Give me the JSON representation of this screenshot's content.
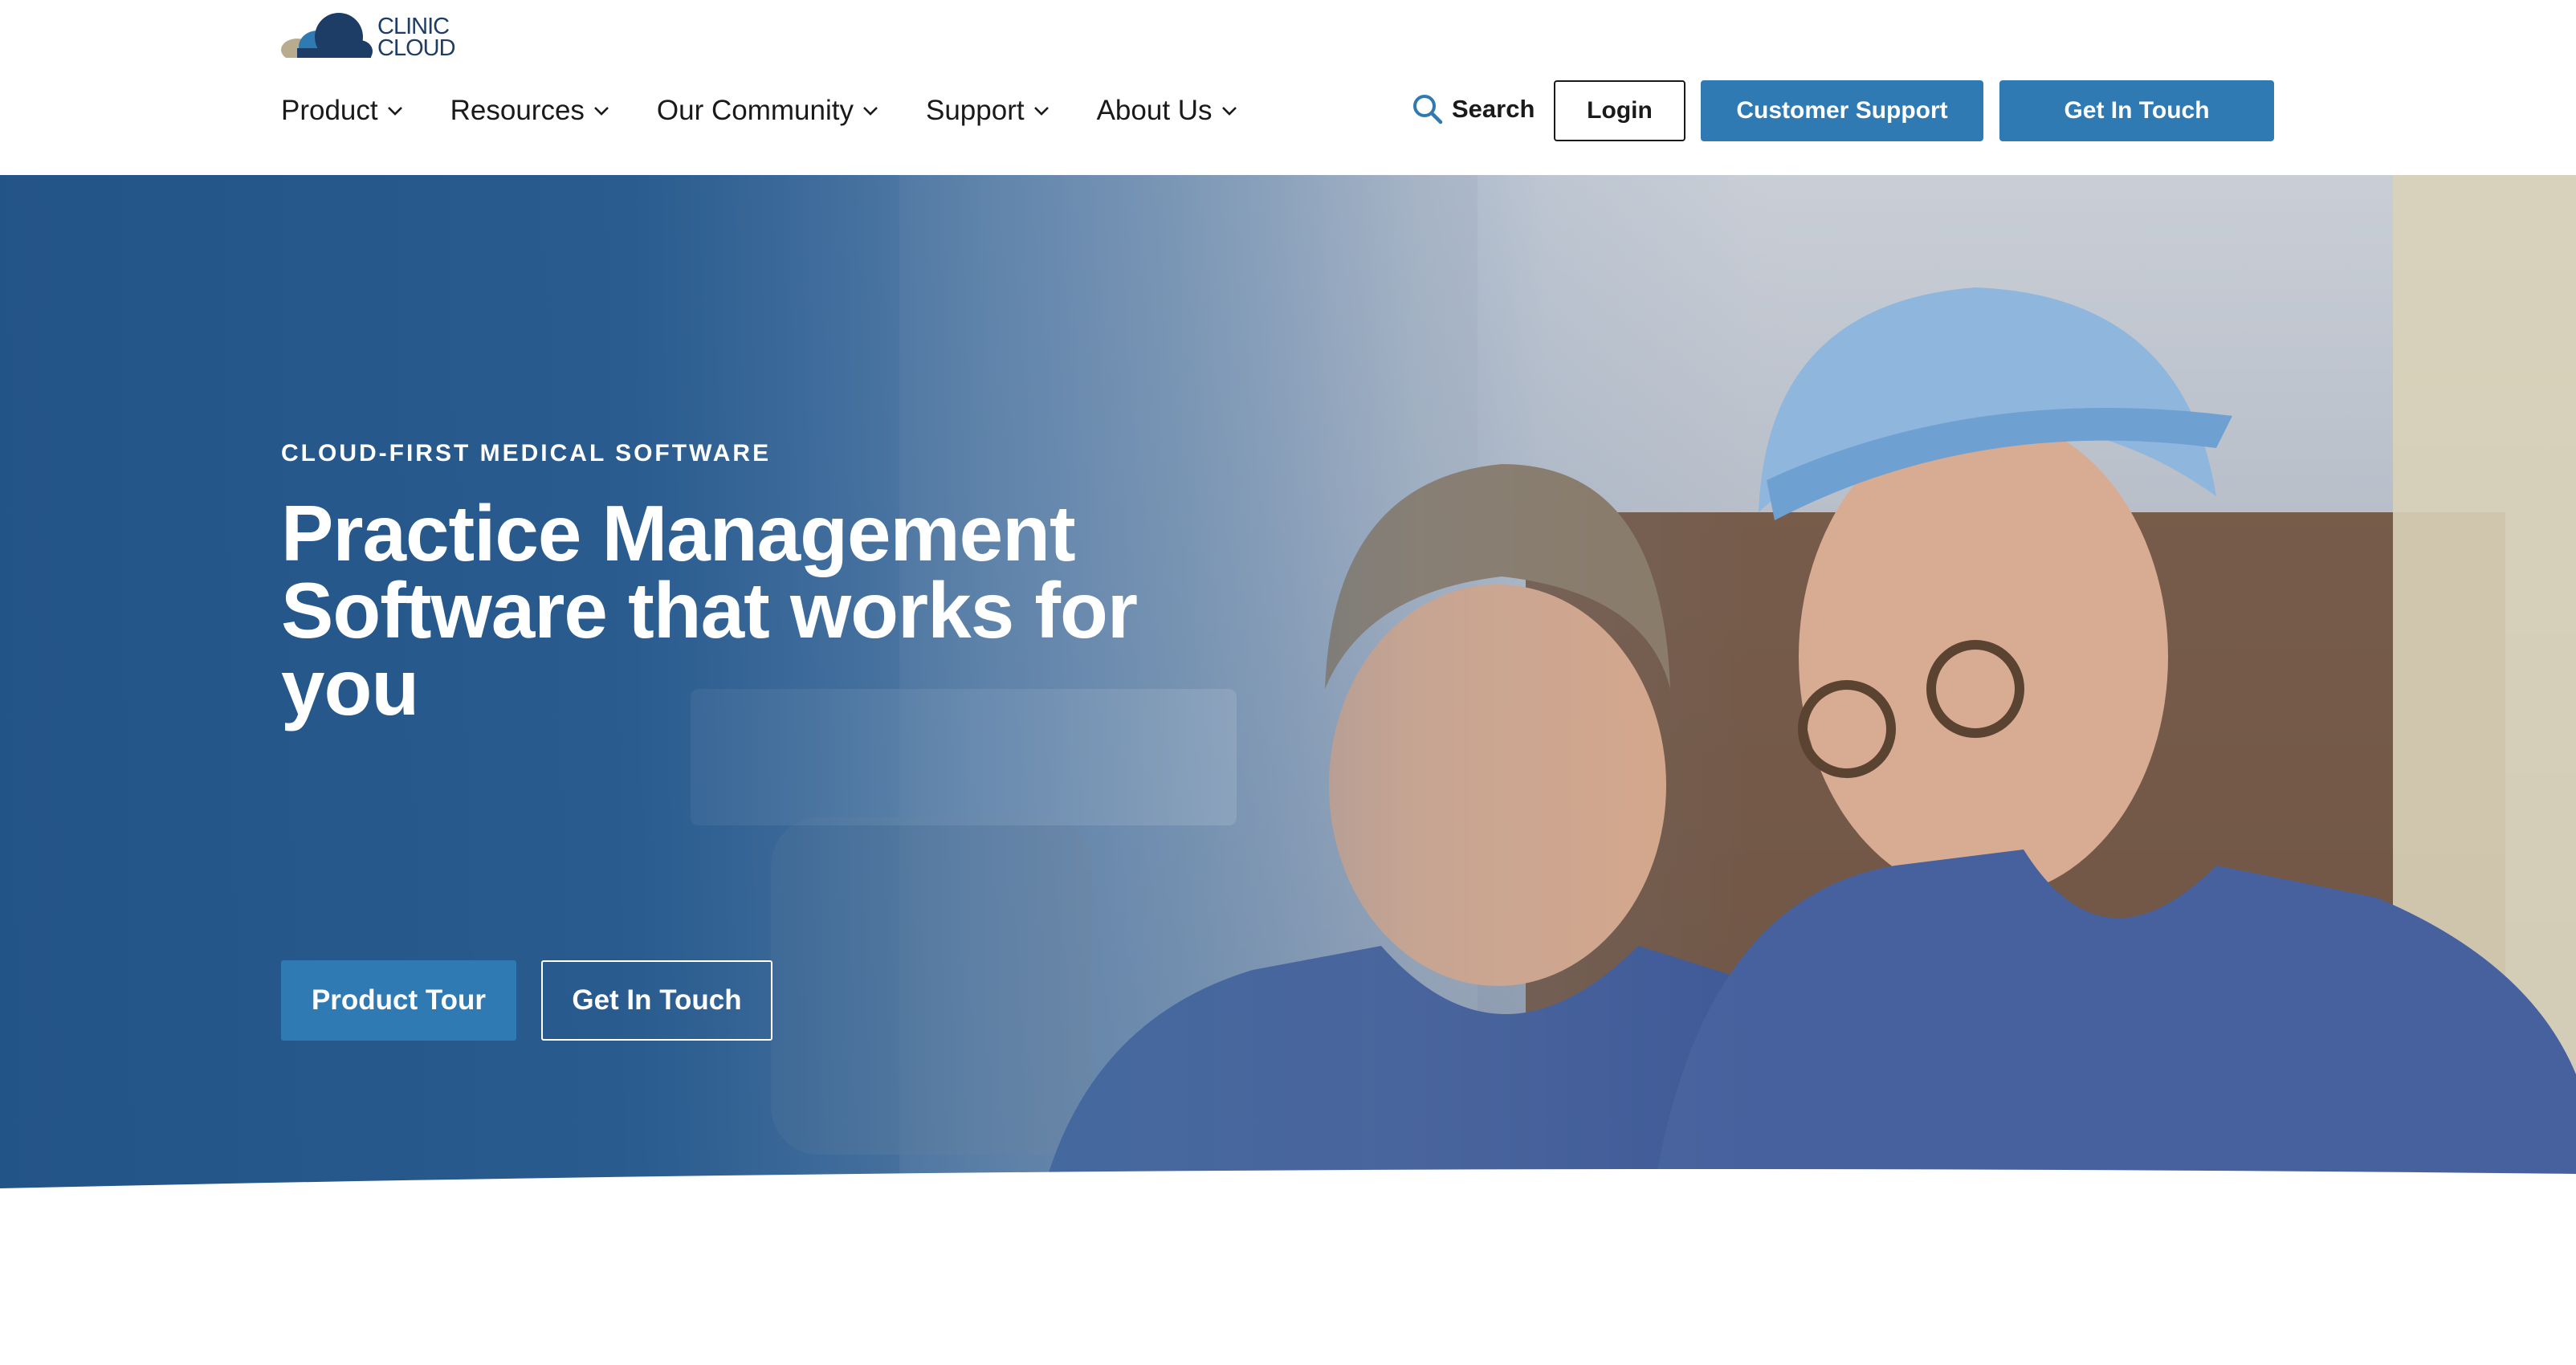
{
  "brand": {
    "logo_line1": "CLINIC",
    "logo_line2": "CLOUD",
    "colors": {
      "primary": "#2f7ab3",
      "navy": "#1d3d66",
      "text": "#1a1a1a"
    }
  },
  "nav": {
    "items": [
      {
        "label": "Product",
        "icon": "chevron-down-icon"
      },
      {
        "label": "Resources",
        "icon": "chevron-down-icon"
      },
      {
        "label": "Our Community",
        "icon": "chevron-down-icon"
      },
      {
        "label": "Support",
        "icon": "chevron-down-icon"
      },
      {
        "label": "About Us",
        "icon": "chevron-down-icon"
      }
    ],
    "search_label": "Search",
    "search_icon": "search-icon",
    "login_label": "Login",
    "customer_support_label": "Customer Support",
    "get_in_touch_label": "Get In Touch"
  },
  "hero": {
    "eyebrow": "CLOUD-FIRST MEDICAL SOFTWARE",
    "headline": "Practice Management Software that works for you",
    "primary_cta": "Product Tour",
    "secondary_cta": "Get In Touch"
  }
}
